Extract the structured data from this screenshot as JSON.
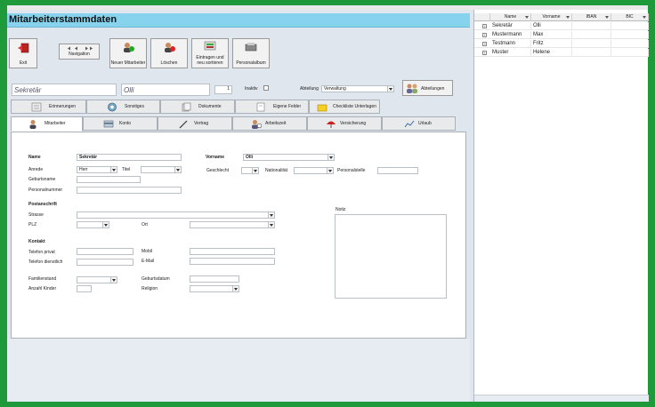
{
  "page": {
    "title": "Mitarbeiterstammdaten"
  },
  "toolbar": {
    "exit": "Exit",
    "navigation": "Navigation",
    "new": "Neuer Mitarbeiter",
    "delete": "Löschen",
    "sort": "Eintragen und neu sortieren",
    "album": "Personalalbum"
  },
  "header": {
    "name_value": "Sekretär",
    "firstname_value": "Olli",
    "counter_value": "1",
    "inactive_label": "Inaktiv",
    "department_label": "Abteilung",
    "department_value": "Verwaltung",
    "departments_button": "Abteilungen"
  },
  "tabs_row1": [
    "Erinnerungen",
    "Sonstiges",
    "Dokumente",
    "Eigene Felder",
    "Checkliste Unterlagen"
  ],
  "tabs_row2": [
    "Mitarbeiter",
    "Konto",
    "Vertrag",
    "Arbeitszeit",
    "Versicherung",
    "Urlaub"
  ],
  "form": {
    "name_label": "Name",
    "name_value": "Sekretär",
    "vorname_label": "Vorname",
    "vorname_value": "Olli",
    "anrede_label": "Anrede",
    "anrede_value": "Herr",
    "titel_label": "Titel",
    "geschlecht_label": "Geschlecht",
    "nationalitaet_label": "Nationalität",
    "personalstelle_label": "Personalstelle",
    "geburtsname_label": "Geburtsname",
    "personalnummer_label": "Personalnummer",
    "postanschrift_label": "Postanschrift",
    "strasse_label": "Strasse",
    "plz_label": "PLZ",
    "ort_label": "Ort",
    "notiz_label": "Notiz",
    "kontakt_label": "Kontakt",
    "tel_privat_label": "Telefon privat",
    "tel_dienst_label": "Telefon dienstlich",
    "mobil_label": "Mobil",
    "email_label": "E-Mail",
    "familienstand_label": "Familienstand",
    "kinder_label": "Anzahl Kinder",
    "geburtsdatum_label": "Geburtsdatum",
    "religion_label": "Religion"
  },
  "grid": {
    "columns": [
      "Name",
      "Vorname",
      "IBAN",
      "BIC"
    ],
    "rows": [
      {
        "name": "Sekretär",
        "vorname": "Olli"
      },
      {
        "name": "Mustermann",
        "vorname": "Max"
      },
      {
        "name": "Testmann",
        "vorname": "Fritz"
      },
      {
        "name": "Muster",
        "vorname": "Helene"
      }
    ]
  },
  "colors": {
    "frame": "#1f9a3a",
    "header": "#87d2ec",
    "panel": "#dfe6ee"
  }
}
